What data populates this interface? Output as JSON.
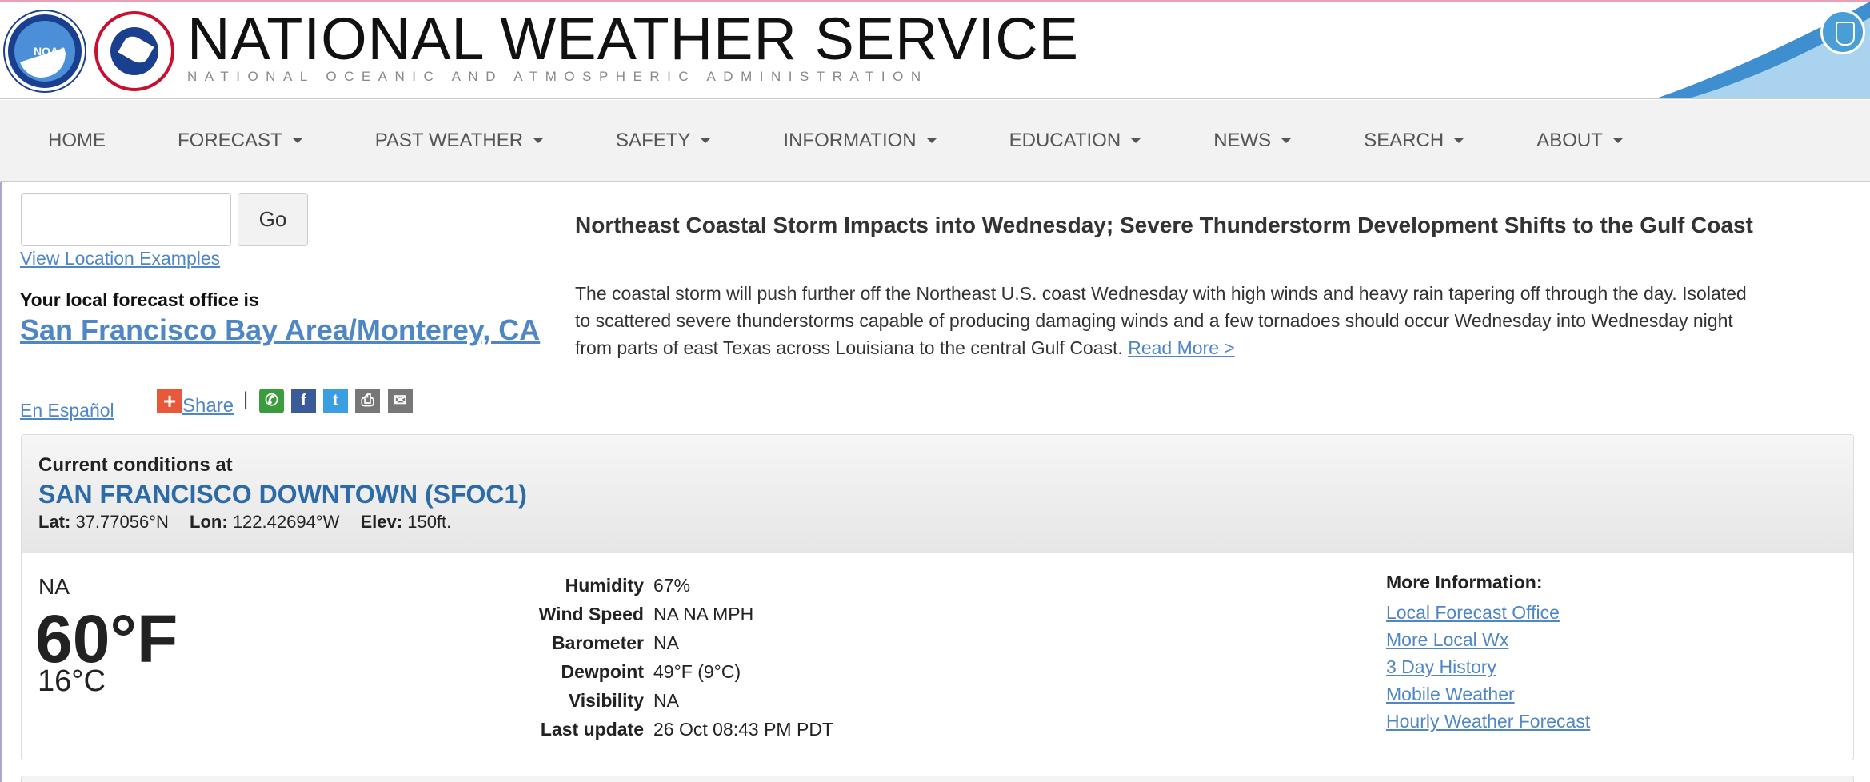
{
  "header": {
    "title": "NATIONAL WEATHER SERVICE",
    "subtitle": "NATIONAL OCEANIC AND ATMOSPHERIC ADMINISTRATION",
    "noaa_logo_text": "NOAA",
    "nws_logo_text": "NATIONAL WEATHER SERVICE"
  },
  "nav": {
    "items": [
      {
        "label": "HOME",
        "dropdown": false
      },
      {
        "label": "FORECAST",
        "dropdown": true
      },
      {
        "label": "PAST WEATHER",
        "dropdown": true
      },
      {
        "label": "SAFETY",
        "dropdown": true
      },
      {
        "label": "INFORMATION",
        "dropdown": true
      },
      {
        "label": "EDUCATION",
        "dropdown": true
      },
      {
        "label": "NEWS",
        "dropdown": true
      },
      {
        "label": "SEARCH",
        "dropdown": true
      },
      {
        "label": "ABOUT",
        "dropdown": true
      }
    ]
  },
  "search": {
    "value": "",
    "placeholder": "",
    "go_label": "Go",
    "examples_link": "View Location Examples"
  },
  "local_office": {
    "label": "Your local forecast office is",
    "name": "San Francisco Bay Area/Monterey, CA"
  },
  "language_link": "En Español",
  "share": {
    "label": "Share",
    "separator": "|",
    "icons": [
      "whatsapp-icon",
      "facebook-icon",
      "twitter-icon",
      "print-icon",
      "email-icon"
    ]
  },
  "headline": {
    "title": "Northeast Coastal Storm Impacts into Wednesday; Severe Thunderstorm Development Shifts to the Gulf Coast",
    "body": "The coastal storm will push further off the Northeast U.S. coast Wednesday with high winds and heavy rain tapering off through the day. Isolated to scattered severe thunderstorms capable of producing damaging winds and a few tornadoes should occur Wednesday into Wednesday night from parts of east Texas across Louisiana to the central Gulf Coast.",
    "read_more": "Read More >"
  },
  "current_conditions": {
    "label": "Current conditions at",
    "station": "SAN FRANCISCO DOWNTOWN (SFOC1)",
    "lat_label": "Lat:",
    "lat": "37.77056°N",
    "lon_label": "Lon:",
    "lon": "122.42694°W",
    "elev_label": "Elev:",
    "elev": "150ft.",
    "condition": "NA",
    "temp_f": "60°F",
    "temp_c": "16°C",
    "observations": [
      {
        "label": "Humidity",
        "value": "67%"
      },
      {
        "label": "Wind Speed",
        "value": "NA NA MPH"
      },
      {
        "label": "Barometer",
        "value": "NA"
      },
      {
        "label": "Dewpoint",
        "value": "49°F (9°C)"
      },
      {
        "label": "Visibility",
        "value": "NA"
      },
      {
        "label": "Last update",
        "value": "26 Oct 08:43 PM PDT"
      }
    ],
    "more_info": {
      "title": "More Information:",
      "links": [
        "Local Forecast Office",
        "More Local Wx",
        "3 Day History",
        "Mobile Weather",
        "Hourly Weather Forecast"
      ]
    }
  },
  "colors": {
    "link": "#4f86c6",
    "station": "#2d6aa8",
    "nav_bg": "#f2f2f2",
    "share_plus": "#e8593c"
  }
}
